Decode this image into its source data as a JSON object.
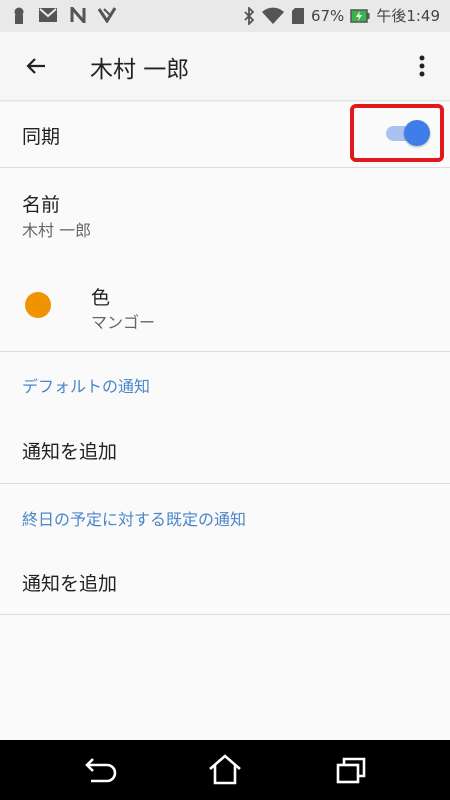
{
  "status_bar": {
    "battery": "67%",
    "time": "午後1:49"
  },
  "app_bar": {
    "title": "木村 一郎"
  },
  "settings": {
    "sync_label": "同期",
    "sync_enabled": true,
    "name_label": "名前",
    "name_value": "木村 一郎",
    "color_label": "色",
    "color_value": "マンゴー",
    "color_hex": "#f09300",
    "default_notifications_header": "デフォルトの通知",
    "add_notification_1": "通知を追加",
    "allday_notifications_header": "終日の予定に対する既定の通知",
    "add_notification_2": "通知を追加"
  },
  "icons": [
    "back-arrow-icon",
    "more-vert-icon",
    "back-icon",
    "home-icon",
    "recents-icon"
  ]
}
